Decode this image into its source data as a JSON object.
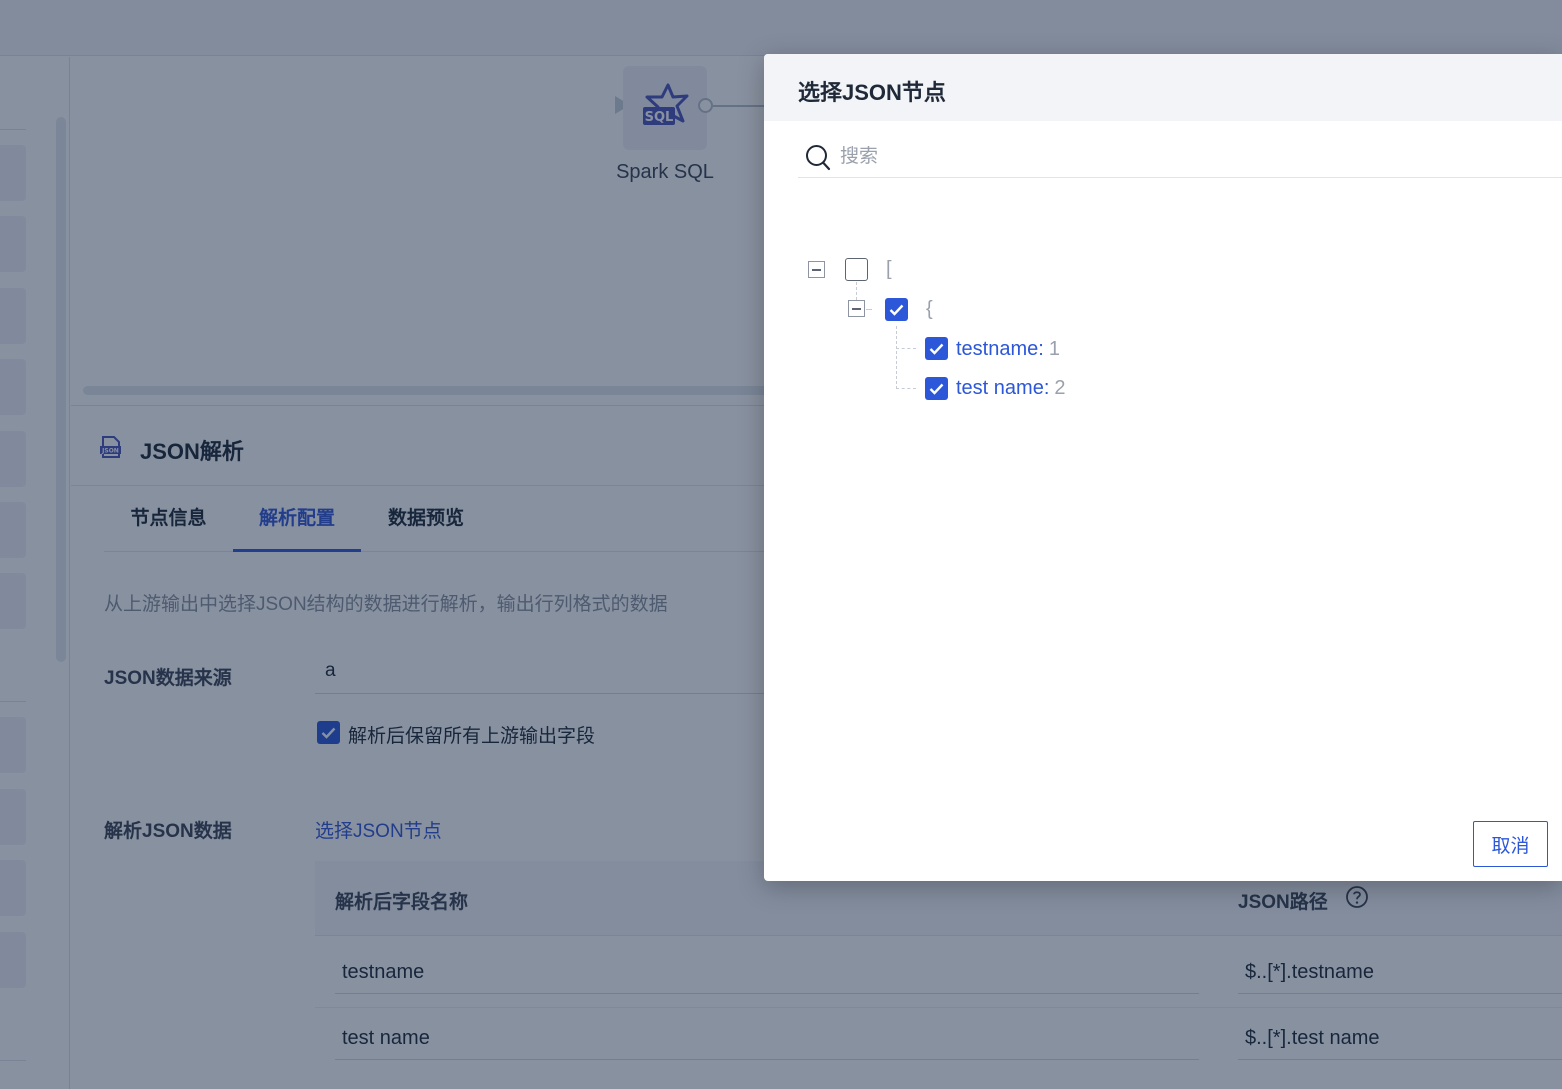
{
  "canvas": {
    "node": {
      "label": "Spark SQL",
      "icon": "spark-sql-icon",
      "badge": "SQL"
    }
  },
  "panel": {
    "icon": "json-file-icon",
    "icon_text": "JSON",
    "title": "JSON解析",
    "tabs": [
      {
        "label": "节点信息",
        "active": false
      },
      {
        "label": "解析配置",
        "active": true
      },
      {
        "label": "数据预览",
        "active": false
      }
    ],
    "description": "从上游输出中选择JSON结构的数据进行解析，输出行列格式的数据",
    "source_label": "JSON数据来源",
    "source_value": "a",
    "keep_fields_label": "解析后保留所有上游输出字段",
    "keep_fields_checked": true,
    "parse_label": "解析JSON数据",
    "select_link": "选择JSON节点",
    "table": {
      "columns": [
        "解析后字段名称",
        "JSON路径"
      ],
      "rows": [
        {
          "name": "testname",
          "path": "$..[*].testname"
        },
        {
          "name": "test name",
          "path": "$..[*].test name"
        }
      ]
    }
  },
  "dialog": {
    "title": "选择JSON节点",
    "search_placeholder": "搜索",
    "tree": {
      "root": {
        "bracket": "[",
        "checked": false
      },
      "object": {
        "bracket": "{",
        "checked": true
      },
      "leaves": [
        {
          "key": "testname:",
          "value": "1",
          "checked": true
        },
        {
          "key": "test name:",
          "value": "2",
          "checked": true
        }
      ]
    },
    "cancel_label": "取消"
  },
  "colors": {
    "accent": "#2c57d8",
    "overlay": "rgba(17,35,66,0.5)",
    "muted_text": "#9aa1ad"
  }
}
